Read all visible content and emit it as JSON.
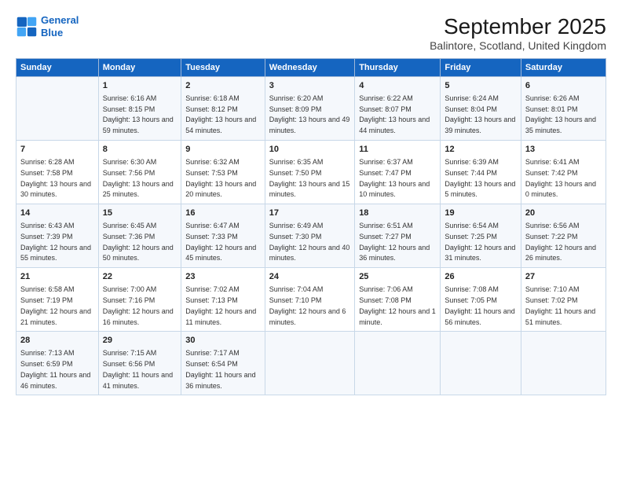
{
  "logo": {
    "line1": "General",
    "line2": "Blue"
  },
  "title": "September 2025",
  "subtitle": "Balintore, Scotland, United Kingdom",
  "header_days": [
    "Sunday",
    "Monday",
    "Tuesday",
    "Wednesday",
    "Thursday",
    "Friday",
    "Saturday"
  ],
  "weeks": [
    [
      {
        "day": "",
        "sunrise": "",
        "sunset": "",
        "daylight": ""
      },
      {
        "day": "1",
        "sunrise": "Sunrise: 6:16 AM",
        "sunset": "Sunset: 8:15 PM",
        "daylight": "Daylight: 13 hours and 59 minutes."
      },
      {
        "day": "2",
        "sunrise": "Sunrise: 6:18 AM",
        "sunset": "Sunset: 8:12 PM",
        "daylight": "Daylight: 13 hours and 54 minutes."
      },
      {
        "day": "3",
        "sunrise": "Sunrise: 6:20 AM",
        "sunset": "Sunset: 8:09 PM",
        "daylight": "Daylight: 13 hours and 49 minutes."
      },
      {
        "day": "4",
        "sunrise": "Sunrise: 6:22 AM",
        "sunset": "Sunset: 8:07 PM",
        "daylight": "Daylight: 13 hours and 44 minutes."
      },
      {
        "day": "5",
        "sunrise": "Sunrise: 6:24 AM",
        "sunset": "Sunset: 8:04 PM",
        "daylight": "Daylight: 13 hours and 39 minutes."
      },
      {
        "day": "6",
        "sunrise": "Sunrise: 6:26 AM",
        "sunset": "Sunset: 8:01 PM",
        "daylight": "Daylight: 13 hours and 35 minutes."
      }
    ],
    [
      {
        "day": "7",
        "sunrise": "Sunrise: 6:28 AM",
        "sunset": "Sunset: 7:58 PM",
        "daylight": "Daylight: 13 hours and 30 minutes."
      },
      {
        "day": "8",
        "sunrise": "Sunrise: 6:30 AM",
        "sunset": "Sunset: 7:56 PM",
        "daylight": "Daylight: 13 hours and 25 minutes."
      },
      {
        "day": "9",
        "sunrise": "Sunrise: 6:32 AM",
        "sunset": "Sunset: 7:53 PM",
        "daylight": "Daylight: 13 hours and 20 minutes."
      },
      {
        "day": "10",
        "sunrise": "Sunrise: 6:35 AM",
        "sunset": "Sunset: 7:50 PM",
        "daylight": "Daylight: 13 hours and 15 minutes."
      },
      {
        "day": "11",
        "sunrise": "Sunrise: 6:37 AM",
        "sunset": "Sunset: 7:47 PM",
        "daylight": "Daylight: 13 hours and 10 minutes."
      },
      {
        "day": "12",
        "sunrise": "Sunrise: 6:39 AM",
        "sunset": "Sunset: 7:44 PM",
        "daylight": "Daylight: 13 hours and 5 minutes."
      },
      {
        "day": "13",
        "sunrise": "Sunrise: 6:41 AM",
        "sunset": "Sunset: 7:42 PM",
        "daylight": "Daylight: 13 hours and 0 minutes."
      }
    ],
    [
      {
        "day": "14",
        "sunrise": "Sunrise: 6:43 AM",
        "sunset": "Sunset: 7:39 PM",
        "daylight": "Daylight: 12 hours and 55 minutes."
      },
      {
        "day": "15",
        "sunrise": "Sunrise: 6:45 AM",
        "sunset": "Sunset: 7:36 PM",
        "daylight": "Daylight: 12 hours and 50 minutes."
      },
      {
        "day": "16",
        "sunrise": "Sunrise: 6:47 AM",
        "sunset": "Sunset: 7:33 PM",
        "daylight": "Daylight: 12 hours and 45 minutes."
      },
      {
        "day": "17",
        "sunrise": "Sunrise: 6:49 AM",
        "sunset": "Sunset: 7:30 PM",
        "daylight": "Daylight: 12 hours and 40 minutes."
      },
      {
        "day": "18",
        "sunrise": "Sunrise: 6:51 AM",
        "sunset": "Sunset: 7:27 PM",
        "daylight": "Daylight: 12 hours and 36 minutes."
      },
      {
        "day": "19",
        "sunrise": "Sunrise: 6:54 AM",
        "sunset": "Sunset: 7:25 PM",
        "daylight": "Daylight: 12 hours and 31 minutes."
      },
      {
        "day": "20",
        "sunrise": "Sunrise: 6:56 AM",
        "sunset": "Sunset: 7:22 PM",
        "daylight": "Daylight: 12 hours and 26 minutes."
      }
    ],
    [
      {
        "day": "21",
        "sunrise": "Sunrise: 6:58 AM",
        "sunset": "Sunset: 7:19 PM",
        "daylight": "Daylight: 12 hours and 21 minutes."
      },
      {
        "day": "22",
        "sunrise": "Sunrise: 7:00 AM",
        "sunset": "Sunset: 7:16 PM",
        "daylight": "Daylight: 12 hours and 16 minutes."
      },
      {
        "day": "23",
        "sunrise": "Sunrise: 7:02 AM",
        "sunset": "Sunset: 7:13 PM",
        "daylight": "Daylight: 12 hours and 11 minutes."
      },
      {
        "day": "24",
        "sunrise": "Sunrise: 7:04 AM",
        "sunset": "Sunset: 7:10 PM",
        "daylight": "Daylight: 12 hours and 6 minutes."
      },
      {
        "day": "25",
        "sunrise": "Sunrise: 7:06 AM",
        "sunset": "Sunset: 7:08 PM",
        "daylight": "Daylight: 12 hours and 1 minute."
      },
      {
        "day": "26",
        "sunrise": "Sunrise: 7:08 AM",
        "sunset": "Sunset: 7:05 PM",
        "daylight": "Daylight: 11 hours and 56 minutes."
      },
      {
        "day": "27",
        "sunrise": "Sunrise: 7:10 AM",
        "sunset": "Sunset: 7:02 PM",
        "daylight": "Daylight: 11 hours and 51 minutes."
      }
    ],
    [
      {
        "day": "28",
        "sunrise": "Sunrise: 7:13 AM",
        "sunset": "Sunset: 6:59 PM",
        "daylight": "Daylight: 11 hours and 46 minutes."
      },
      {
        "day": "29",
        "sunrise": "Sunrise: 7:15 AM",
        "sunset": "Sunset: 6:56 PM",
        "daylight": "Daylight: 11 hours and 41 minutes."
      },
      {
        "day": "30",
        "sunrise": "Sunrise: 7:17 AM",
        "sunset": "Sunset: 6:54 PM",
        "daylight": "Daylight: 11 hours and 36 minutes."
      },
      {
        "day": "",
        "sunrise": "",
        "sunset": "",
        "daylight": ""
      },
      {
        "day": "",
        "sunrise": "",
        "sunset": "",
        "daylight": ""
      },
      {
        "day": "",
        "sunrise": "",
        "sunset": "",
        "daylight": ""
      },
      {
        "day": "",
        "sunrise": "",
        "sunset": "",
        "daylight": ""
      }
    ]
  ]
}
